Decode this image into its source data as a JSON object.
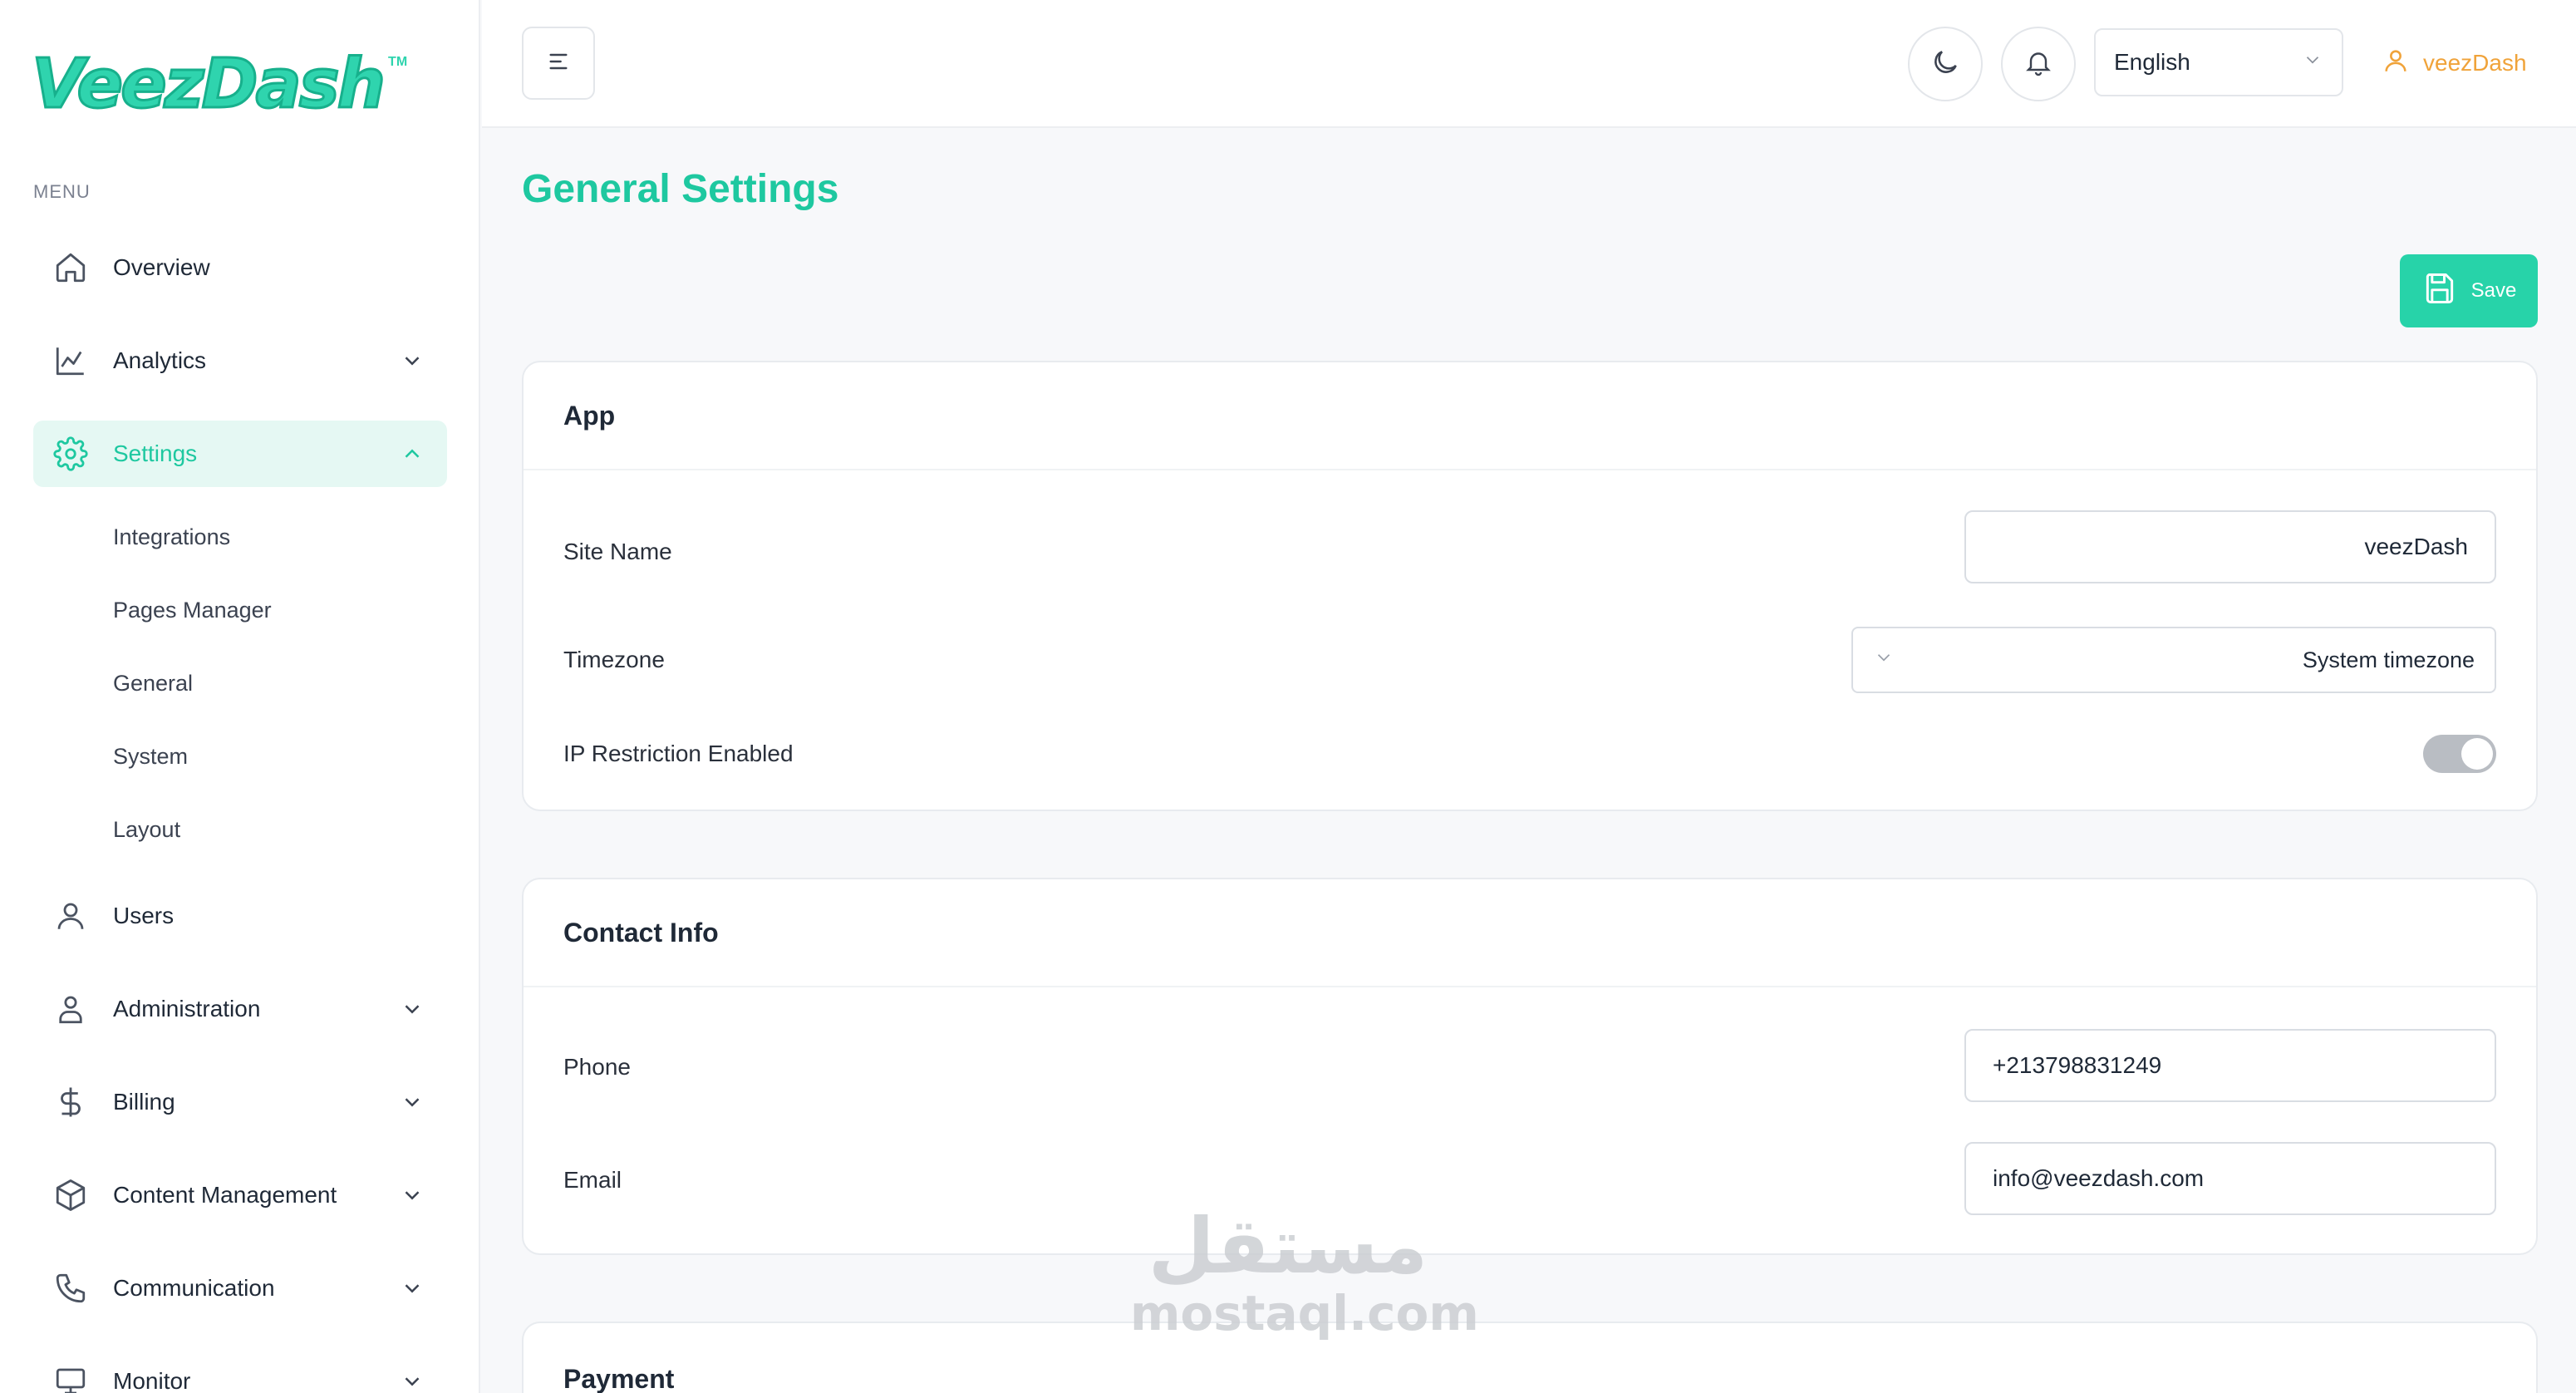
{
  "brand": {
    "name": "VeezDash",
    "tm": "TM",
    "accent": "#1ec8a0"
  },
  "sidebar": {
    "menu_caption": "MENU",
    "items": [
      {
        "label": "Overview",
        "icon": "home-icon",
        "expandable": false
      },
      {
        "label": "Analytics",
        "icon": "chart-icon",
        "expandable": true
      },
      {
        "label": "Settings",
        "icon": "gear-icon",
        "expandable": true,
        "expanded": true,
        "active": true
      },
      {
        "label": "Users",
        "icon": "user-icon",
        "expandable": false
      },
      {
        "label": "Administration",
        "icon": "user-admin-icon",
        "expandable": true
      },
      {
        "label": "Billing",
        "icon": "dollar-icon",
        "expandable": true
      },
      {
        "label": "Content Management",
        "icon": "box-icon",
        "expandable": true
      },
      {
        "label": "Communication",
        "icon": "phone-icon",
        "expandable": true
      },
      {
        "label": "Monitor",
        "icon": "monitor-icon",
        "expandable": true
      }
    ],
    "settings_sub": [
      "Integrations",
      "Pages Manager",
      "General",
      "System",
      "Layout"
    ]
  },
  "topbar": {
    "language": "English",
    "username": "veezDash",
    "icons": [
      "menu-icon",
      "moon-icon",
      "bell-icon",
      "chevron-down-icon",
      "user-icon"
    ]
  },
  "main": {
    "title": "General Settings",
    "save_label": "Save",
    "app": {
      "title": "App",
      "site_name_label": "Site Name",
      "site_name_value": "veezDash",
      "timezone_label": "Timezone",
      "timezone_value": "System timezone",
      "ip_label": "IP Restriction Enabled",
      "ip_enabled": true
    },
    "contact": {
      "title": "Contact Info",
      "phone_label": "Phone",
      "phone_value": "+213798831249",
      "email_label": "Email",
      "email_value": "info@veezdash.com"
    },
    "payment": {
      "title": "Payment"
    }
  },
  "watermark": {
    "ar": "مستقل",
    "en": "mostaql.com"
  }
}
